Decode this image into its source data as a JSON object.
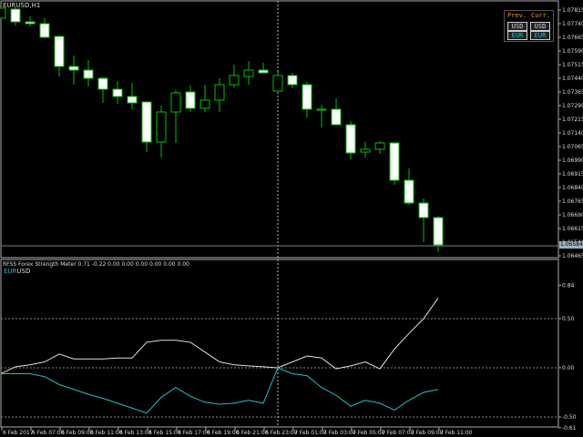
{
  "chart": {
    "symbol_title": "EURUSD,H1",
    "current_price": "1.06584",
    "price_axis": {
      "top": 1.07815,
      "step": 0.00075,
      "labels": [
        "1.07815",
        "1.07740",
        "1.07665",
        "1.07590",
        "1.07515",
        "1.07440",
        "1.07365",
        "1.07290",
        "1.07215",
        "1.07140",
        "1.07065",
        "1.06990",
        "1.06915",
        "1.06840",
        "1.06765",
        "1.06690",
        "1.06615",
        "1.06540",
        "1.06465"
      ]
    },
    "time_labels": [
      "6 Feb 2017",
      "6 Feb 07:00",
      "6 Feb 09:00",
      "6 Feb 11:00",
      "6 Feb 13:00",
      "6 Feb 15:00",
      "6 Feb 17:00",
      "6 Feb 19:00",
      "6 Feb 21:00",
      "6 Feb 23:00",
      "7 Feb 01:00",
      "7 Feb 03:00",
      "7 Feb 05:00",
      "7 Feb 07:00",
      "7 Feb 09:00",
      "7 Feb 11:00"
    ],
    "candles": [
      [
        1.0777,
        1.07825,
        1.0777,
        1.07825
      ],
      [
        1.0782,
        1.0783,
        1.0773,
        1.0775
      ],
      [
        1.0775,
        1.0778,
        1.07725,
        1.0774
      ],
      [
        1.0774,
        1.0777,
        1.07665,
        1.07665
      ],
      [
        1.0767,
        1.07675,
        1.0745,
        1.07505
      ],
      [
        1.07505,
        1.07565,
        1.07405,
        1.07485
      ],
      [
        1.07485,
        1.0754,
        1.07395,
        1.0744
      ],
      [
        1.0744,
        1.07445,
        1.07305,
        1.0738
      ],
      [
        1.0738,
        1.07425,
        1.073,
        1.0734
      ],
      [
        1.0734,
        1.07415,
        1.0727,
        1.07305
      ],
      [
        1.0731,
        1.0731,
        1.07035,
        1.0709
      ],
      [
        1.0709,
        1.0729,
        1.07005,
        1.07255
      ],
      [
        1.07255,
        1.07375,
        1.07085,
        1.0736
      ],
      [
        1.07365,
        1.074,
        1.07255,
        1.07275
      ],
      [
        1.07275,
        1.07405,
        1.07255,
        1.0732
      ],
      [
        1.0732,
        1.0744,
        1.07255,
        1.07405
      ],
      [
        1.07405,
        1.07515,
        1.0739,
        1.07455
      ],
      [
        1.0745,
        1.07535,
        1.07405,
        1.07485
      ],
      [
        1.07485,
        1.07525,
        1.0747,
        1.0747
      ],
      [
        1.0737,
        1.07475,
        1.0737,
        1.07455
      ],
      [
        1.07455,
        1.0747,
        1.07385,
        1.07405
      ],
      [
        1.07405,
        1.0742,
        1.07225,
        1.0727
      ],
      [
        1.0727,
        1.07295,
        1.0717,
        1.07265
      ],
      [
        1.0727,
        1.0733,
        1.07185,
        1.07185
      ],
      [
        1.07185,
        1.07205,
        1.06995,
        1.0703
      ],
      [
        1.07035,
        1.0709,
        1.07005,
        1.0705
      ],
      [
        1.0705,
        1.07095,
        1.07025,
        1.07085
      ],
      [
        1.07085,
        1.07085,
        1.06855,
        1.0688
      ],
      [
        1.0688,
        1.06945,
        1.06745,
        1.06755
      ],
      [
        1.06755,
        1.0678,
        1.0654,
        1.06675
      ],
      [
        1.06675,
        1.06685,
        1.06485,
        1.06525
      ]
    ],
    "colors": {
      "bull_outline": "#00c000",
      "bear_fill": "#ffffff",
      "background": "#000000"
    }
  },
  "panel": {
    "prev_label": "Prev.",
    "curr_label": "Curr.",
    "prev_top": "USD",
    "prev_bottom": "EUR",
    "curr_top": "USD",
    "curr_bottom": "EUR"
  },
  "indicator": {
    "title": "RFSS Forex Strength Meter 0.71 -0.22 0.00 0.00 0.00 0.00 0.00 0.00",
    "legend_eur": "EUR",
    "legend_usd": "USD",
    "axis_labels": [
      "0.84",
      "0.50",
      "0.00",
      "-0.50",
      "-0.61"
    ],
    "axis_values": [
      0.84,
      0.5,
      0.0,
      -0.5,
      -0.61
    ],
    "levels": [
      0.5,
      0,
      -0.5
    ],
    "series": [
      {
        "name": "USD",
        "color": "#e0e0e0",
        "values": [
          -0.06,
          0.01,
          0.03,
          0.06,
          0.14,
          0.09,
          0.09,
          0.09,
          0.1,
          0.1,
          0.26,
          0.28,
          0.28,
          0.26,
          0.16,
          0.06,
          0.03,
          0.02,
          0.01,
          0.0,
          0.06,
          0.12,
          0.1,
          -0.01,
          0.02,
          0.06,
          -0.01,
          0.19,
          0.35,
          0.5,
          0.71
        ]
      },
      {
        "name": "EUR",
        "color": "#20c0c8",
        "values": [
          -0.06,
          -0.06,
          -0.06,
          -0.09,
          -0.17,
          -0.22,
          -0.27,
          -0.31,
          -0.36,
          -0.41,
          -0.46,
          -0.3,
          -0.2,
          -0.29,
          -0.35,
          -0.37,
          -0.36,
          -0.33,
          -0.36,
          0.0,
          -0.06,
          -0.08,
          -0.2,
          -0.28,
          -0.39,
          -0.33,
          -0.36,
          -0.43,
          -0.33,
          -0.25,
          -0.22
        ]
      }
    ]
  }
}
